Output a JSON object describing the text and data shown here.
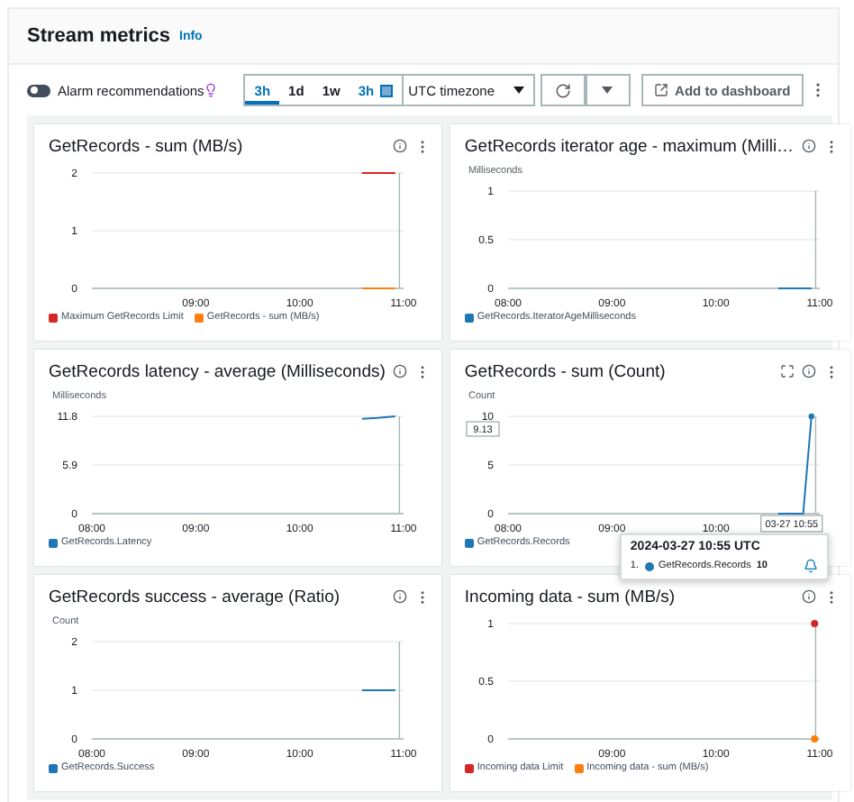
{
  "panel": {
    "title": "Stream metrics",
    "info": "Info"
  },
  "toolbar": {
    "alarm_toggle": {
      "label": "Alarm recommendations",
      "on": false
    },
    "time_ranges": [
      {
        "label": "3h",
        "kind": "preset",
        "selected": true
      },
      {
        "label": "1d",
        "kind": "preset",
        "selected": false
      },
      {
        "label": "1w",
        "kind": "preset",
        "selected": false
      },
      {
        "label": "3h",
        "kind": "custom",
        "selected": false
      }
    ],
    "timezone": "UTC timezone",
    "add_button": "Add to dashboard"
  },
  "widgets": [
    {
      "title": "GetRecords - sum (MB/s)",
      "expandable": false,
      "chart_data": {
        "type": "line",
        "x": [
          10.6,
          10.75,
          10.92
        ],
        "xlim": [
          8,
          11
        ],
        "ylim": [
          0,
          2
        ],
        "xticks": [
          {
            "value": 9,
            "label": "09:00"
          },
          {
            "value": 10,
            "label": "10:00"
          },
          {
            "value": 11,
            "label": "11:00"
          }
        ],
        "yticks": [
          0,
          1,
          2
        ],
        "series": [
          {
            "name": "Maximum GetRecords Limit",
            "color": "#d62728",
            "values": [
              2,
              2,
              2
            ]
          },
          {
            "name": "GetRecords - sum (MB/s)",
            "color": "#ff7f0e",
            "values": [
              0,
              0,
              0
            ]
          }
        ]
      }
    },
    {
      "title": "GetRecords iterator age - maximum (Milli…",
      "expandable": false,
      "chart_data": {
        "type": "line",
        "ylabel": "Milliseconds",
        "x": [
          10.6,
          10.75,
          10.92
        ],
        "xlim": [
          8,
          11
        ],
        "ylim": [
          0,
          1
        ],
        "xticks": [
          {
            "value": 8,
            "label": "08:00"
          },
          {
            "value": 9,
            "label": "09:00"
          },
          {
            "value": 10,
            "label": "10:00"
          },
          {
            "value": 11,
            "label": "11:00"
          }
        ],
        "yticks": [
          0,
          0.5,
          1
        ],
        "series": [
          {
            "name": "GetRecords.IteratorAgeMilliseconds",
            "color": "#1f77b4",
            "values": [
              0,
              0,
              0
            ]
          }
        ]
      }
    },
    {
      "title": "GetRecords latency - average (Milliseconds)",
      "expandable": false,
      "chart_data": {
        "type": "line",
        "ylabel": "Milliseconds",
        "x": [
          10.6,
          10.75,
          10.92
        ],
        "xlim": [
          8,
          11
        ],
        "ylim": [
          0,
          11.8
        ],
        "xticks": [
          {
            "value": 8,
            "label": "08:00"
          },
          {
            "value": 9,
            "label": "09:00"
          },
          {
            "value": 10,
            "label": "10:00"
          },
          {
            "value": 11,
            "label": "11:00"
          }
        ],
        "yticks": [
          0,
          5.9,
          11.8
        ],
        "series": [
          {
            "name": "GetRecords.Latency",
            "color": "#1f77b4",
            "values": [
              11.5,
              11.6,
              11.8
            ]
          }
        ]
      }
    },
    {
      "title": "GetRecords - sum (Count)",
      "expandable": true,
      "chart_data": {
        "type": "line",
        "ylabel": "Count",
        "x": [
          10.6,
          10.68,
          10.76,
          10.84,
          10.92
        ],
        "xlim": [
          8,
          11
        ],
        "ylim": [
          0,
          10
        ],
        "xticks": [
          {
            "value": 8,
            "label": "08:00"
          },
          {
            "value": 9,
            "label": "09:00"
          },
          {
            "value": 10,
            "label": "10:00"
          }
        ],
        "yticks": [
          0,
          5,
          10
        ],
        "series": [
          {
            "name": "GetRecords.Records",
            "color": "#1f77b4",
            "values": [
              0,
              0,
              0,
              0,
              10
            ]
          }
        ]
      },
      "crosshair": {
        "y_label": "9.13",
        "x_label": "03-27 10:55"
      },
      "tooltip": {
        "title": "2024-03-27 10:55 UTC",
        "rows": [
          {
            "index": "1.",
            "name": "GetRecords.Records",
            "value": "10",
            "color": "#1f77b4"
          }
        ]
      }
    },
    {
      "title": "GetRecords success - average (Ratio)",
      "expandable": false,
      "chart_data": {
        "type": "line",
        "ylabel": "Count",
        "x": [
          10.6,
          10.75,
          10.92
        ],
        "xlim": [
          8,
          11
        ],
        "ylim": [
          0,
          2
        ],
        "xticks": [
          {
            "value": 8,
            "label": "08:00"
          },
          {
            "value": 9,
            "label": "09:00"
          },
          {
            "value": 10,
            "label": "10:00"
          },
          {
            "value": 11,
            "label": "11:00"
          }
        ],
        "yticks": [
          0,
          1,
          2
        ],
        "series": [
          {
            "name": "GetRecords.Success",
            "color": "#1f77b4",
            "values": [
              1,
              1,
              1
            ]
          }
        ]
      }
    },
    {
      "title": "Incoming data - sum (MB/s)",
      "expandable": false,
      "chart_data": {
        "type": "line",
        "x": [
          10.95
        ],
        "xlim": [
          8,
          11
        ],
        "ylim": [
          0,
          1
        ],
        "xticks": [
          {
            "value": 9,
            "label": "09:00"
          },
          {
            "value": 10,
            "label": "10:00"
          },
          {
            "value": 11,
            "label": "11:00"
          }
        ],
        "yticks": [
          0,
          0.5,
          1
        ],
        "series": [
          {
            "name": "Incoming data Limit",
            "color": "#d62728",
            "marker": "circle",
            "values": [
              1
            ]
          },
          {
            "name": "Incoming data - sum (MB/s)",
            "color": "#ff7f0e",
            "marker": "circle",
            "values": [
              0
            ]
          }
        ]
      }
    }
  ]
}
